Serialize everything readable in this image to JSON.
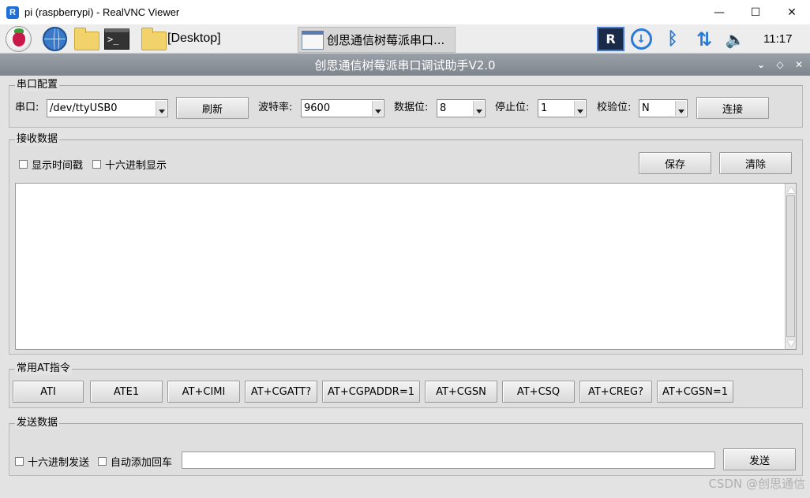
{
  "window": {
    "app_icon_letter": "R",
    "title": "pi (raspberrypi) - RealVNC Viewer",
    "minimize": "—",
    "maximize": "☐",
    "close": "✕"
  },
  "panel": {
    "terminal_prompt": ">_",
    "desktop_label": "[Desktop]",
    "task_button": "创思通信树莓派串口...",
    "vnc_icon_text": "R",
    "download_glyph": "↓",
    "bluetooth_glyph": "ᛒ",
    "network_glyph": "⇅",
    "volume_glyph": "🔈",
    "clock": "11:17"
  },
  "app": {
    "title": "创思通信树莓派串口调试助手V2.0",
    "ctrl_min": "⌄",
    "ctrl_max": "◇",
    "ctrl_close": "✕"
  },
  "serial_config": {
    "group_label": "串口配置",
    "port_label": "串口:",
    "port_value": "/dev/ttyUSB0",
    "refresh_button": "刷新",
    "baud_label": "波特率:",
    "baud_value": "9600",
    "databits_label": "数据位:",
    "databits_value": "8",
    "stopbits_label": "停止位:",
    "stopbits_value": "1",
    "parity_label": "校验位:",
    "parity_value": "N",
    "connect_button": "连接"
  },
  "receive": {
    "group_label": "接收数据",
    "show_timestamp": "显示时间戳",
    "hex_display": "十六进制显示",
    "save_button": "保存",
    "clear_button": "清除"
  },
  "at_commands": {
    "group_label": "常用AT指令",
    "buttons": [
      "ATI",
      "ATE1",
      "AT+CIMI",
      "AT+CGATT?",
      "AT+CGPADDR=1",
      "AT+CGSN",
      "AT+CSQ",
      "AT+CREG?",
      "AT+CGSN=1"
    ]
  },
  "send": {
    "group_label": "发送数据",
    "hex_send": "十六进制发送",
    "auto_crlf": "自动添加回车",
    "input_value": "",
    "send_button": "发送"
  },
  "watermark": "CSDN @创思通信"
}
